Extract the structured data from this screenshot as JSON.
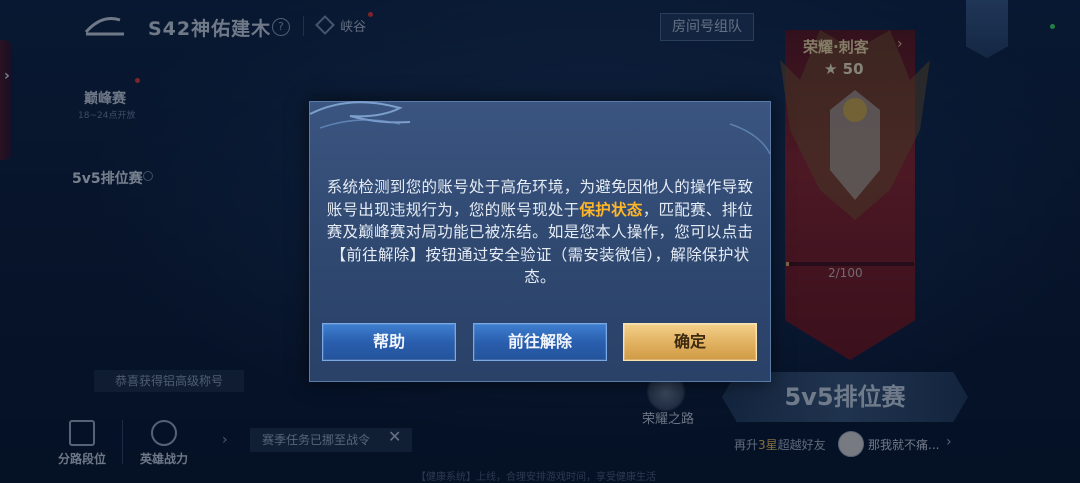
{
  "header": {
    "season_title": "S42神佑建木",
    "help_glyph": "?",
    "region": "峡谷",
    "room_button": "房间号组队"
  },
  "modes": {
    "peak": {
      "label": "巅峰赛",
      "time": "18~24点开放"
    },
    "ranked": {
      "label": "5v5排位赛"
    }
  },
  "rank": {
    "name": "荣耀·刺客",
    "stars": "★ 50",
    "progress_text": "2/100",
    "progress_fraction": 0.02
  },
  "bottom": {
    "congrats": "恭喜获得铝高级称号",
    "nav": [
      {
        "label": "分路段位"
      },
      {
        "label": "英雄战力"
      }
    ],
    "task": "赛季任务已挪至战令",
    "honor_road": "荣耀之路",
    "ranked_button": "5v5排位赛",
    "friend_tip_prefix": "再升",
    "friend_tip_highlight": "3星",
    "friend_tip_suffix": "超越好友",
    "friend_message": "那我就不痛...",
    "footer_notice": "【健康系统】上线，合理安排游戏时间，享受健康生活"
  },
  "dialog": {
    "message_part1": "系统检测到您的账号处于高危环境，为避免因他人的操作导致账号出现违规行为，您的账号现处于",
    "message_highlight": "保护状态",
    "message_part2": "，匹配赛、排位赛及巅峰赛对局功能已被冻结。如是您本人操作，您可以点击【前往解除】按钮通过安全验证（需安装微信），解除保护状态。",
    "buttons": {
      "help": "帮助",
      "unlock": "前往解除",
      "confirm": "确定"
    }
  },
  "colors": {
    "highlight": "#ffb627",
    "button_blue": "#2a5fae",
    "button_gold": "#e2b362"
  }
}
